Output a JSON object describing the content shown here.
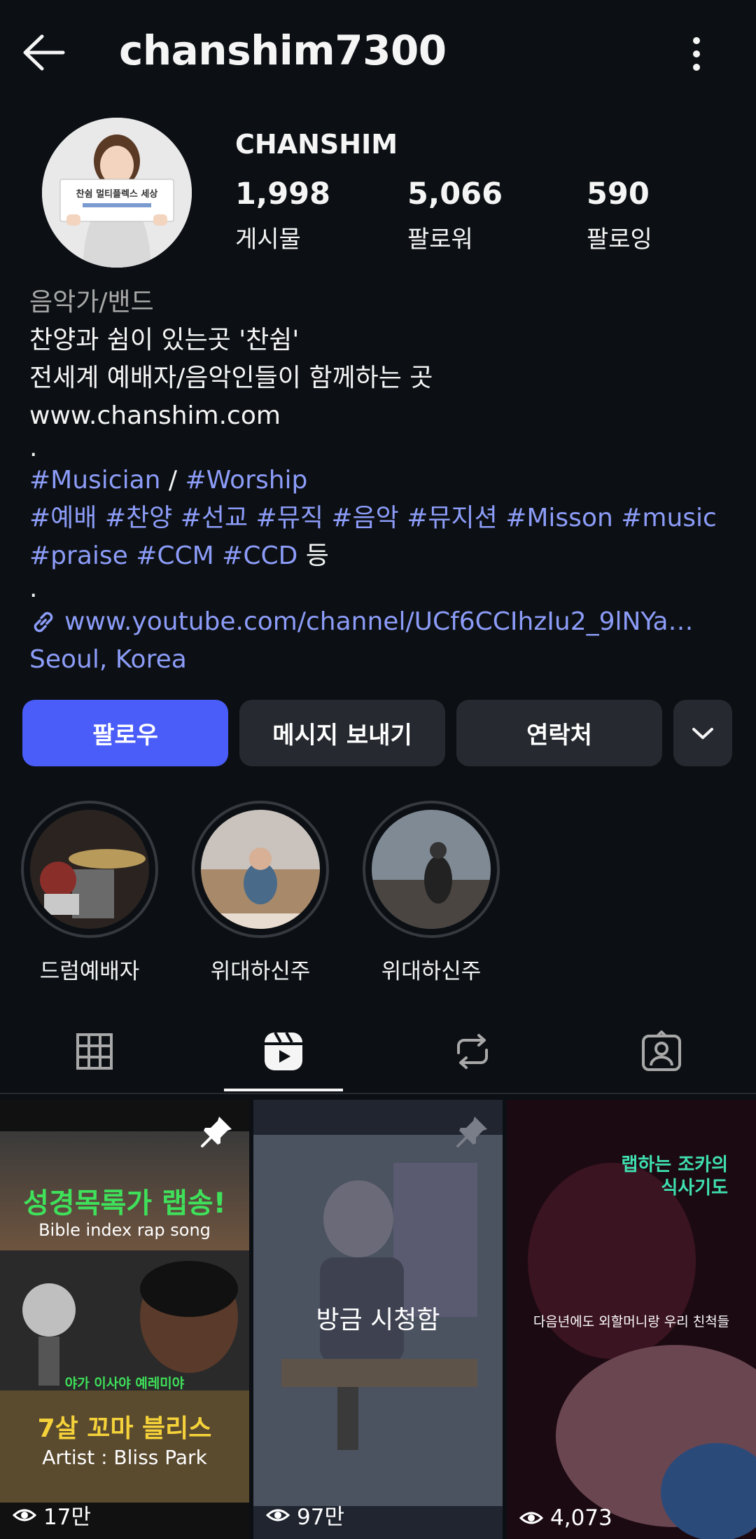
{
  "header": {
    "username": "chanshim7300"
  },
  "profile": {
    "display_name": "CHANSHIM",
    "avatar_sign_text": "찬쉼 멀티플렉스 세상",
    "stats": [
      {
        "value": "1,998",
        "label": "게시물"
      },
      {
        "value": "5,066",
        "label": "팔로워"
      },
      {
        "value": "590",
        "label": "팔로잉"
      }
    ]
  },
  "bio": {
    "category": "음악가/밴드",
    "line1": "찬양과 쉼이 있는곳 '찬쉼'",
    "line2": "전세계 예배자/음악인들이 함께하는 곳",
    "website": "www.chanshim.com",
    "dot1": ".",
    "tag_musician": "#Musician",
    "slash": " / ",
    "tag_worship": "#Worship",
    "tags_line2": "#예배 #찬양 #선교 #뮤직 #음악 #뮤지션 #Misson #music",
    "tags_line3": "#praise #CCM  #CCD",
    "etc": " 등",
    "dot2": ".",
    "link": "www.youtube.com/channel/UCf6CCIhzIu2_9lNYa…",
    "location": "Seoul, Korea"
  },
  "actions": {
    "follow": "팔로우",
    "message": "메시지 보내기",
    "contact": "연락처"
  },
  "highlights": [
    {
      "name": "드럼예배자"
    },
    {
      "name": "위대하신주"
    },
    {
      "name": "위대하신주"
    }
  ],
  "tabs": {
    "icons": [
      "grid-icon",
      "reels-icon",
      "reposts-icon",
      "tagged-icon"
    ],
    "active": 1
  },
  "reels": [
    {
      "title": "성경목록가 랩송!",
      "subtitle": "Bible index rap song",
      "names": "야가  이사야  예레미야",
      "bottom_title": "7살 꼬마 블리스",
      "artist": "Artist : Bliss Park",
      "views": "17만"
    },
    {
      "overlay": "방금 시청함",
      "views": "97만"
    },
    {
      "caption_top_1": "랩하는 조카의",
      "caption_top_2": "식사기도",
      "caption_mid": "다음년에도 외할머니랑 우리 친척들",
      "views": "4,073"
    }
  ],
  "colors": {
    "accent": "#4a5df9",
    "link": "#8c9cf8",
    "background": "#0c1014",
    "button": "#262a30"
  }
}
